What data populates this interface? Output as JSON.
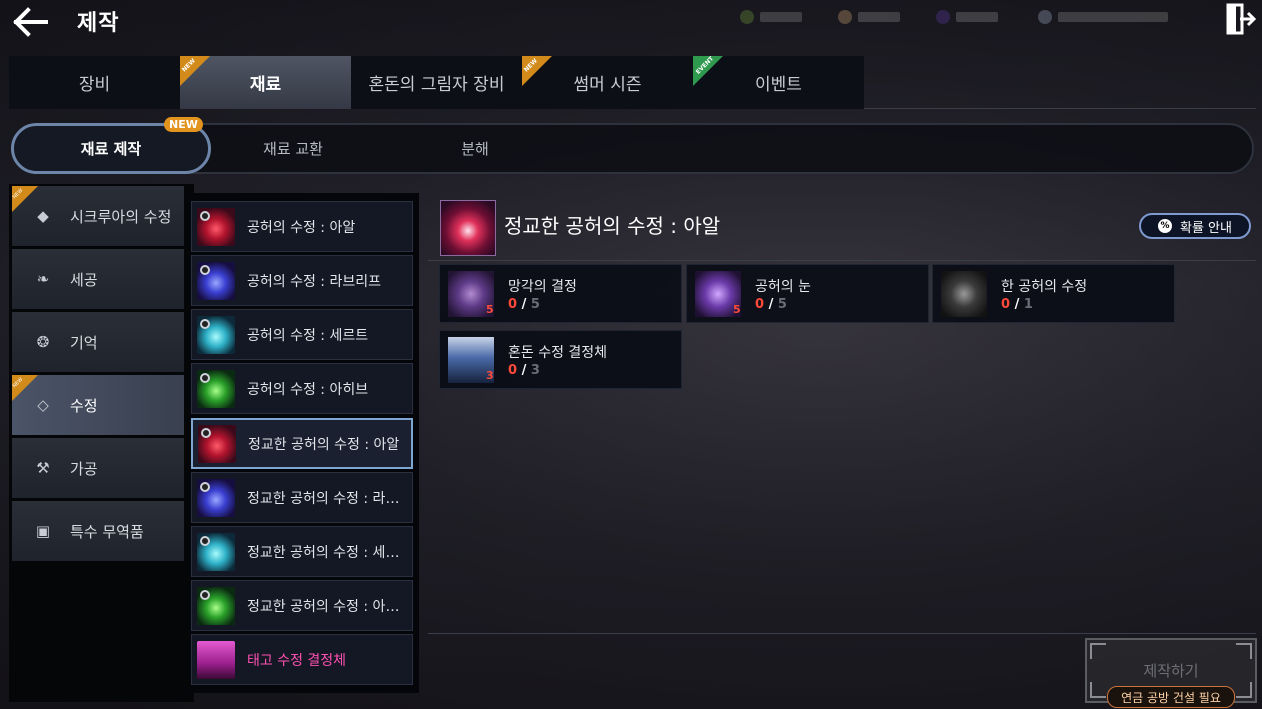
{
  "header": {
    "title": "제작"
  },
  "main_tabs": [
    {
      "label": "장비",
      "badge": ""
    },
    {
      "label": "재료",
      "badge": "NEW"
    },
    {
      "label": "혼돈의 그림자 장비",
      "badge": ""
    },
    {
      "label": "썸머 시즌",
      "badge": "NEW"
    },
    {
      "label": "이벤트",
      "badge": "EVENT"
    }
  ],
  "sub_tabs": [
    {
      "label": "재료 제작"
    },
    {
      "label": "재료 교환"
    },
    {
      "label": "분해"
    }
  ],
  "sub_badge": "NEW",
  "categories": [
    {
      "label": "시크루아의 수정",
      "badge": "NEW",
      "icon": "drop-icon"
    },
    {
      "label": "세공",
      "badge": "",
      "icon": "feather-icon"
    },
    {
      "label": "기억",
      "badge": "",
      "icon": "emblem-icon"
    },
    {
      "label": "수정",
      "badge": "NEW",
      "icon": "diamond-icon"
    },
    {
      "label": "가공",
      "badge": "",
      "icon": "hammer-icon"
    },
    {
      "label": "특수 무역품",
      "badge": "",
      "icon": "ticket-icon"
    }
  ],
  "items": [
    {
      "label": "공허의 수정 : 아알",
      "gem": "red"
    },
    {
      "label": "공허의 수정 : 라브리프",
      "gem": "blue"
    },
    {
      "label": "공허의 수정 : 세르트",
      "gem": "cyan"
    },
    {
      "label": "공허의 수정 : 아히브",
      "gem": "green"
    },
    {
      "label": "정교한 공허의 수정 : 아알",
      "gem": "red"
    },
    {
      "label": "정교한 공허의 수정 : 라브리프",
      "gem": "blue"
    },
    {
      "label": "정교한 공허의 수정 : 세르트",
      "gem": "cyan"
    },
    {
      "label": "정교한 공허의 수정 : 아히브",
      "gem": "green"
    },
    {
      "label": "태고 수정 결정체",
      "gem": "bottle"
    }
  ],
  "detail": {
    "title": "정교한 공허의 수정 : 아알",
    "prob_button": "확률 안내",
    "materials": [
      {
        "name": "망각의 결정",
        "have": "0",
        "need": "5",
        "qty": "5"
      },
      {
        "name": "공허의 눈",
        "have": "0",
        "need": "5",
        "qty": "5"
      },
      {
        "name": "한 공허의 수정",
        "have": "0",
        "need": "1",
        "qty": ""
      },
      {
        "name": "혼돈 수정 결정체",
        "have": "0",
        "need": "3",
        "qty": "3"
      }
    ]
  },
  "craft": {
    "label": "제작하기",
    "note": "연금 공방 건설 필요"
  },
  "colors": {
    "accent": "#7da6d0",
    "new_badge": "#e2941e",
    "event_badge": "#2f9a4d",
    "shortage": "#ff4a3a",
    "special_item": "#ff4fb0"
  }
}
